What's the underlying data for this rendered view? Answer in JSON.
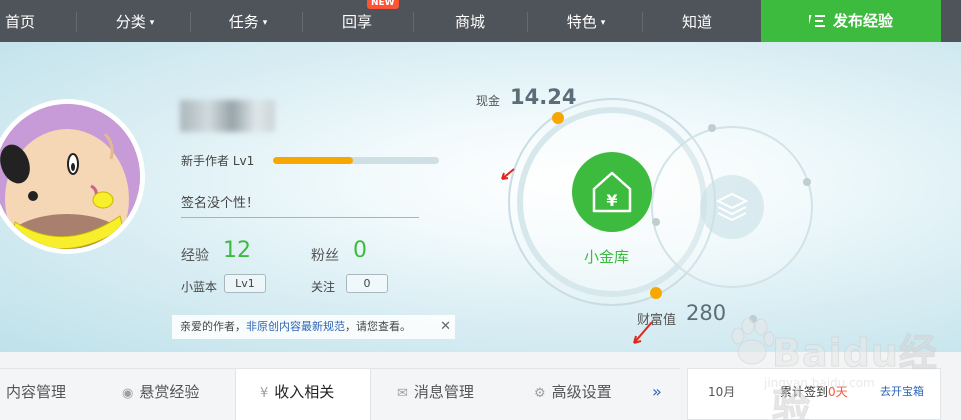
{
  "nav": {
    "home": "首页",
    "category": "分类",
    "tasks": "任务",
    "share": "回享",
    "new_badge": "NEW",
    "mall": "商城",
    "features": "特色",
    "zhidao": "知道",
    "publish": "发布经验"
  },
  "profile": {
    "level_label": "新手作者 Lv1",
    "level_progress": 0.48,
    "signature": "签名没个性！",
    "experience_label": "经验",
    "experience_value": "12",
    "fans_label": "粉丝",
    "fans_value": "0",
    "blue_book_label": "小蓝本",
    "blue_book_value": "Lv1",
    "follow_label": "关注",
    "follow_value": "0"
  },
  "notice": {
    "prefix": "亲爱的作者，",
    "link": "非原创内容最新规范",
    "suffix": "，请您查看。",
    "close": "✕"
  },
  "wealth": {
    "cash_label": "现金",
    "cash_value": "14.24",
    "vault_label": "小金库",
    "wealth_label": "财富值",
    "wealth_value": "280"
  },
  "tabs": [
    {
      "label": "内容管理"
    },
    {
      "label": "悬赏经验"
    },
    {
      "label": "收入相关"
    },
    {
      "label": "消息管理"
    },
    {
      "label": "高级设置"
    }
  ],
  "tabs_more": "»",
  "checkin": {
    "month": "10月",
    "streak_prefix": "累计签到",
    "streak_value": "0天",
    "go": "去开宝箱"
  },
  "watermark": {
    "text": "Baidu经验",
    "sub": "jingyan.baidu.com"
  },
  "colors": {
    "nav_bg": "#4f535a",
    "accent_green": "#3dbb3e",
    "progress": "#f7a800",
    "link_blue": "#2d64b3",
    "badge_red": "#ff5335"
  }
}
